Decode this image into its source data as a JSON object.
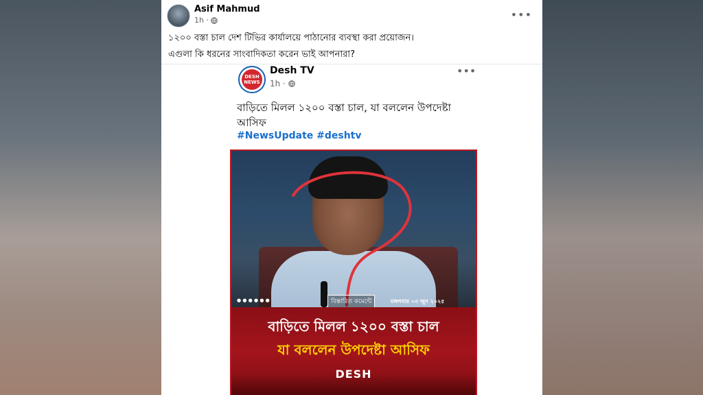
{
  "post": {
    "author": "Asif Mahmud",
    "time": "1h ·",
    "text_line1": "১২০০ বস্তা চাল দেশ টিভির কার্যালয়ে পাঠানোর ব্যবস্থা করা প্রয়োজন।",
    "text_line2": "এগুলা কি ধরনের সাংবাদিকতা করেন ভাই আপনারা?"
  },
  "shared": {
    "page_name": "Desh TV",
    "logo_line1": "DESH",
    "logo_line2": "NEWS",
    "time": "1h ·",
    "headline": "বাড়িতে মিলল ১২০০ বস্তা চাল, যা বললেন উপদেষ্টা আসিফ",
    "hashtags": "#NewsUpdate #deshtv",
    "image": {
      "caption": "বিস্তারিত কমেন্টে",
      "date": "মঙ্গলবার ০৩ জুন ২০২৫",
      "banner_line1": "বাড়িতে মিলল ১২০০ বস্তা চাল",
      "banner_line2": "যা বললেন উপদেষ্টা আসিফ",
      "banner_logo": "DESH"
    }
  },
  "menu_icon": "ellipsis-icon",
  "colors": {
    "hashtag": "#1a6fcf",
    "banner_red": "#a3141b",
    "banner_yellow": "#ffd400",
    "question_mark": "#e0333b"
  }
}
